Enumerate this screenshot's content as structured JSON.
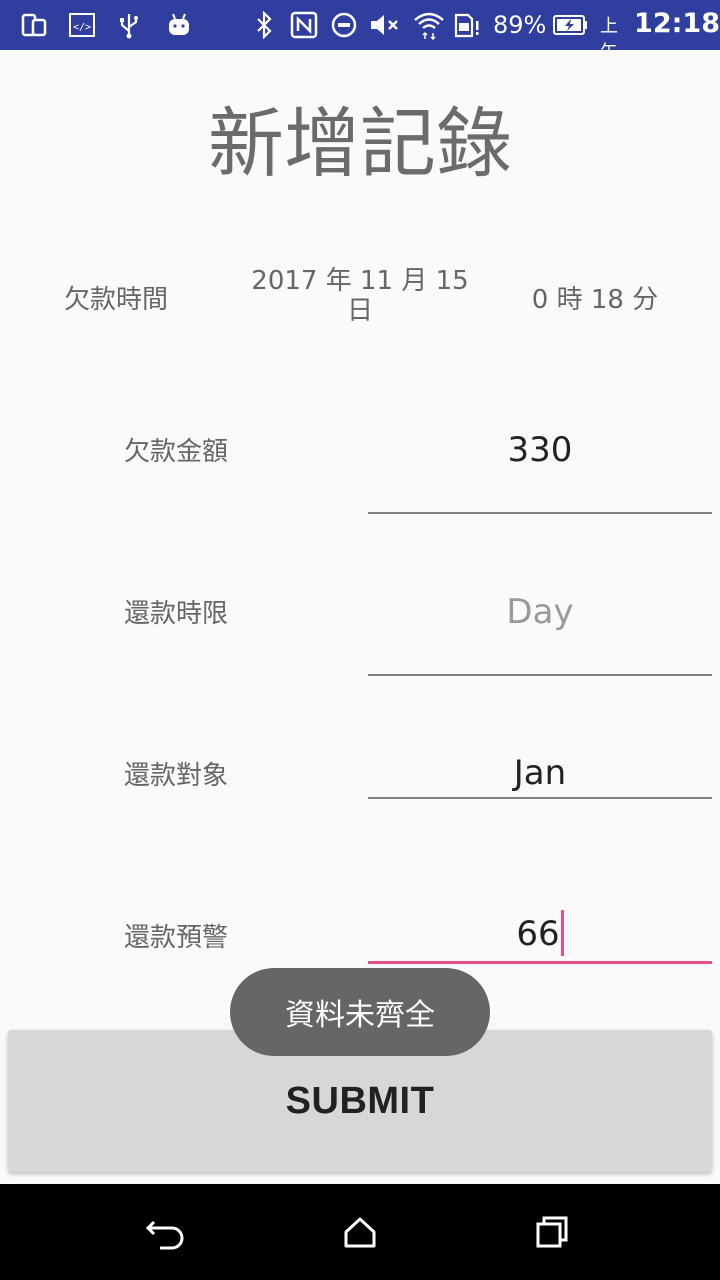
{
  "status_bar": {
    "icons": [
      "screen-mirror-icon",
      "developer-code-icon",
      "usb-icon",
      "android-debug-icon",
      "bluetooth-icon",
      "nfc-icon",
      "do-not-disturb-icon",
      "mute-icon",
      "wifi-icon",
      "sim-alert-icon",
      "battery-charging-icon"
    ],
    "battery": "89%",
    "ampm": "上午",
    "time": "12:18"
  },
  "page": {
    "title": "新增記錄"
  },
  "form": {
    "debt_time_label": "欠款時間",
    "date": "2017 年 11 月 15 日",
    "time": "0 時 18 分",
    "amount_label": "欠款金額",
    "amount_value": "330",
    "deadline_label": "還款時限",
    "deadline_placeholder": "Day",
    "target_label": "還款對象",
    "target_value": "Jan",
    "warning_label": "還款預警",
    "warning_value": "66"
  },
  "submit_label": "SUBMIT",
  "toast": "資料未齊全",
  "nav": {
    "items": [
      "back-icon",
      "home-icon",
      "recents-icon"
    ]
  },
  "colors": {
    "status_bar": "#303f9f",
    "accent": "#e5508a",
    "button": "#d6d7d7",
    "toast": "#666666"
  }
}
